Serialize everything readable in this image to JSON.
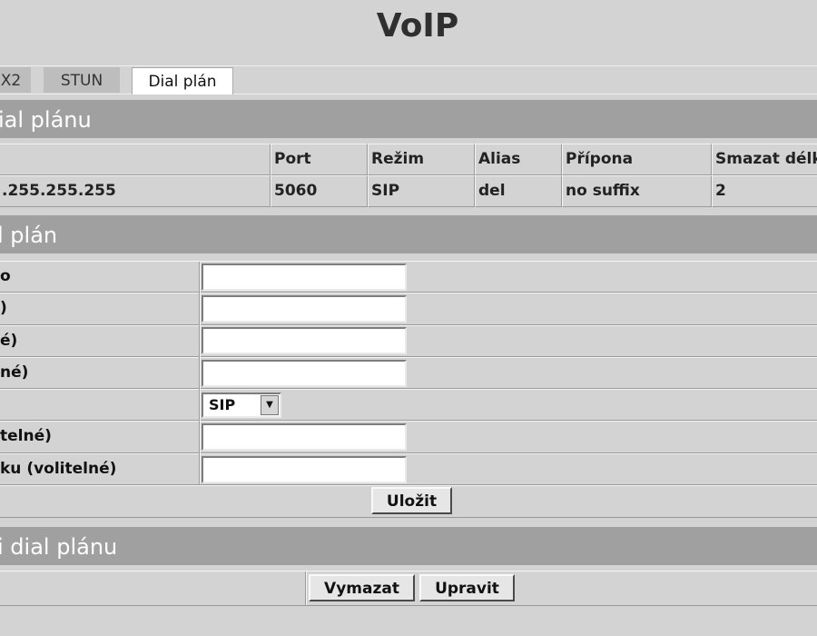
{
  "page": {
    "title": "VoIP"
  },
  "tabs": [
    {
      "label": "X2",
      "active": false
    },
    {
      "label": "STUN",
      "active": false
    },
    {
      "label": "Dial plán",
      "active": true
    }
  ],
  "list_section": {
    "heading": "ial plánu",
    "columns": [
      "",
      "Port",
      "Režim",
      "Alias",
      "Přípona",
      "Smazat délk"
    ],
    "rows": [
      [
        ".255.255.255",
        "5060",
        "SIP",
        "del",
        "no suffix",
        "2"
      ]
    ]
  },
  "form_section": {
    "heading": "l plán",
    "fields": [
      {
        "label": "o",
        "type": "text",
        "value": ""
      },
      {
        "label": ")",
        "type": "text",
        "value": ""
      },
      {
        "label": "é)",
        "type": "text",
        "value": ""
      },
      {
        "label": "né)",
        "type": "text",
        "value": ""
      },
      {
        "label": "",
        "type": "select",
        "value": "SIP"
      },
      {
        "label": "telné)",
        "type": "text",
        "value": ""
      },
      {
        "label": "ku (volitelné)",
        "type": "text",
        "value": ""
      }
    ],
    "save_label": "Uložit"
  },
  "edit_section": {
    "heading": "i dial plánu",
    "delete_label": "Vymazat",
    "edit_label": "Upravit"
  },
  "colors": {
    "background": "#d3d3d3",
    "section_header": "#a0a0a0",
    "active_tab": "#ffffff",
    "inactive_tab": "#bdbdbd"
  },
  "icons": {
    "select_arrow": "chevron-down-icon"
  }
}
